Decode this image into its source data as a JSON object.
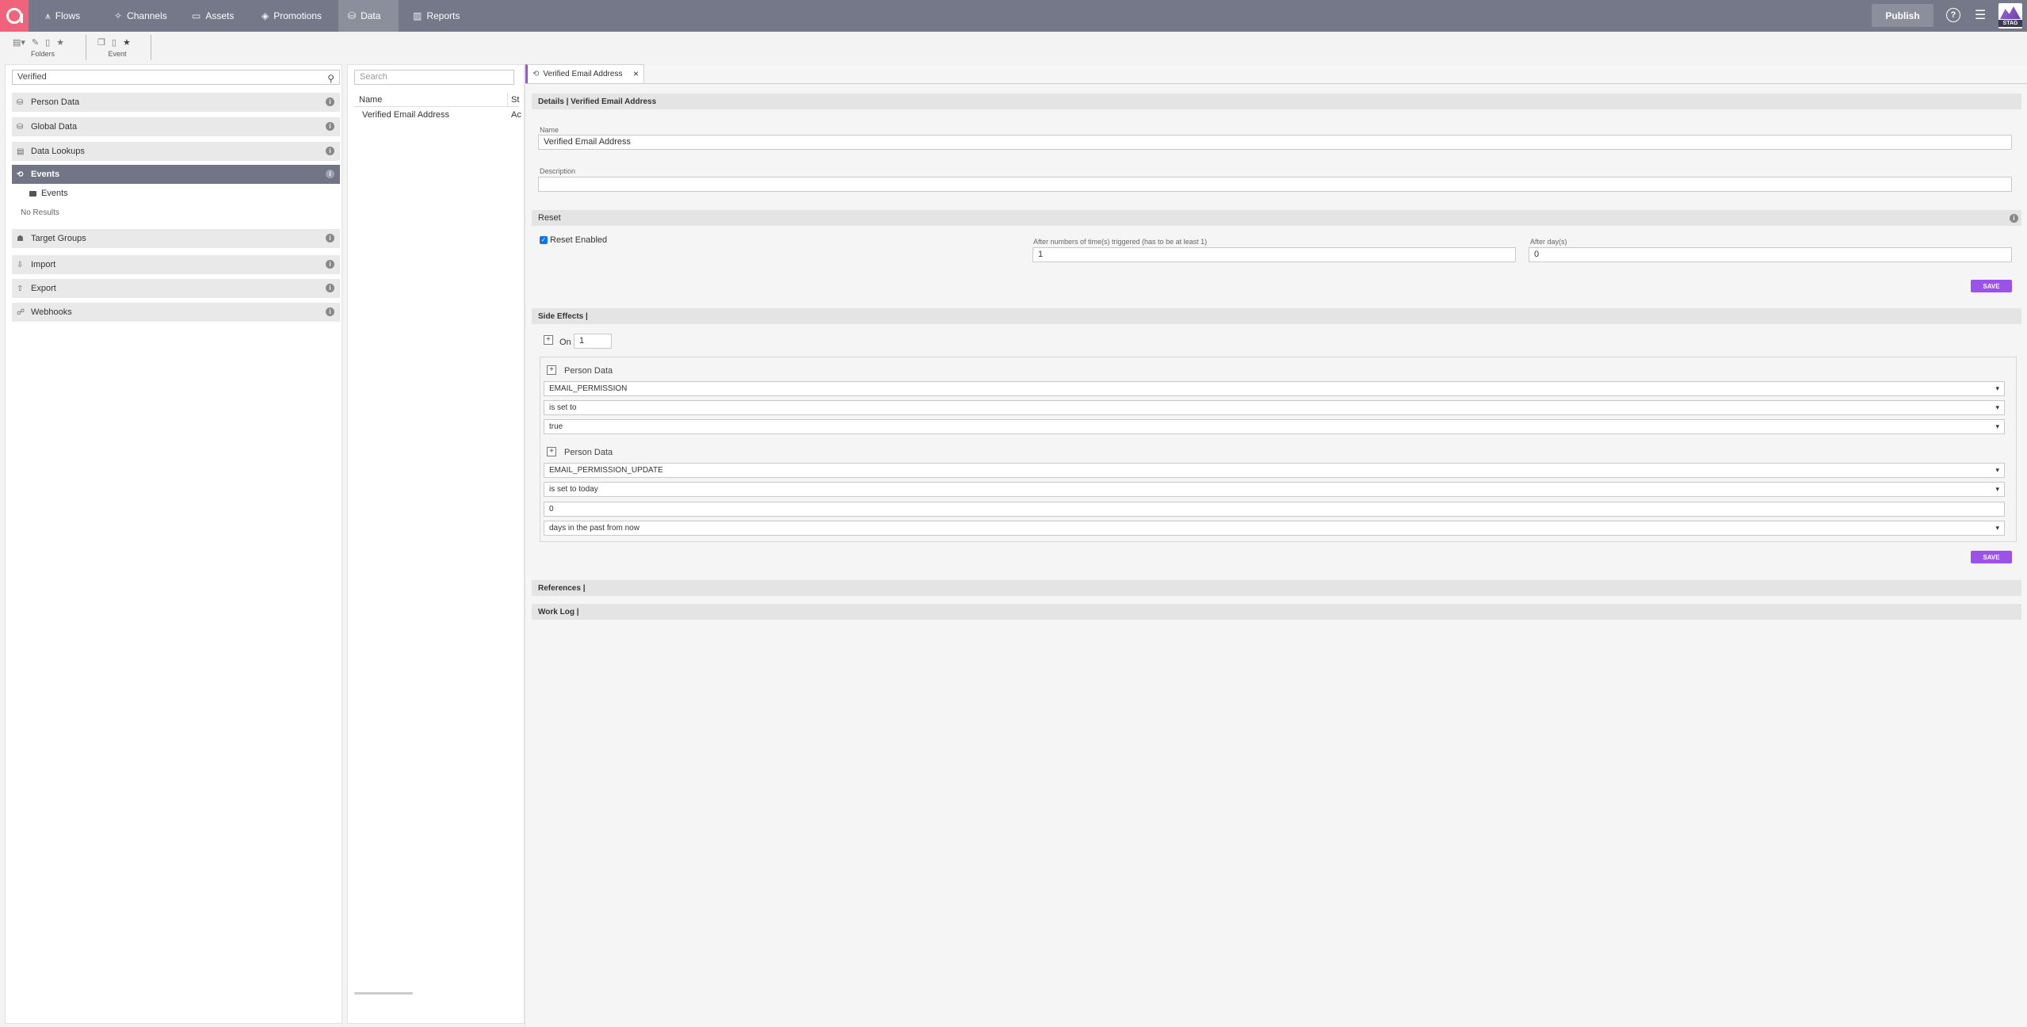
{
  "nav": {
    "items": [
      {
        "label": "Flows",
        "icon": "flows-icon"
      },
      {
        "label": "Channels",
        "icon": "channels-icon"
      },
      {
        "label": "Assets",
        "icon": "assets-icon"
      },
      {
        "label": "Promotions",
        "icon": "promotions-icon"
      },
      {
        "label": "Data",
        "icon": "data-icon",
        "active": true
      },
      {
        "label": "Reports",
        "icon": "reports-icon"
      }
    ],
    "publish_label": "Publish",
    "help_symbol": "?",
    "env_badge": "STAG"
  },
  "toolbar": {
    "folders_label": "Folders",
    "event_label": "Event"
  },
  "left": {
    "search_value": "Verified",
    "categories": [
      {
        "label": "Person Data"
      },
      {
        "label": "Global Data"
      },
      {
        "label": "Data Lookups"
      },
      {
        "label": "Events",
        "active": true
      },
      {
        "label": "Target Groups"
      },
      {
        "label": "Import"
      },
      {
        "label": "Export"
      },
      {
        "label": "Webhooks"
      }
    ],
    "sub_item": "Events",
    "no_results": "No Results"
  },
  "middle": {
    "search_placeholder": "Search",
    "col_name": "Name",
    "col_status": "St",
    "rows": [
      {
        "name": "Verified Email Address",
        "status": "Ac"
      }
    ]
  },
  "detail": {
    "tab_label": "Verified Email Address",
    "details_header": "Details | Verified Email Address",
    "name_label": "Name",
    "name_value": "Verified Email Address",
    "description_label": "Description",
    "description_value": "",
    "reset_header": "Reset",
    "reset_enabled_label": "Reset Enabled",
    "reset_enabled": true,
    "after_times_label": "After numbers of time(s) triggered (has to be at least 1)",
    "after_times_value": "1",
    "after_days_label": "After day(s)",
    "after_days_value": "0",
    "save_label": "SAVE",
    "side_effects_header": "Side Effects |",
    "on_label": "On",
    "on_value": "1",
    "side_effects": [
      {
        "title": "Person Data",
        "field": "EMAIL_PERMISSION",
        "operator": "is set to",
        "value": "true"
      },
      {
        "title": "Person Data",
        "field": "EMAIL_PERMISSION_UPDATE",
        "operator": "is set to today",
        "value": "0",
        "direction": "days in the past from now"
      }
    ],
    "references_header": "References |",
    "worklog_header": "Work Log |"
  },
  "colors": {
    "nav_bg": "#747888",
    "accent": "#9a52e8",
    "logo": "#f0637a",
    "active_category": "#717585"
  }
}
